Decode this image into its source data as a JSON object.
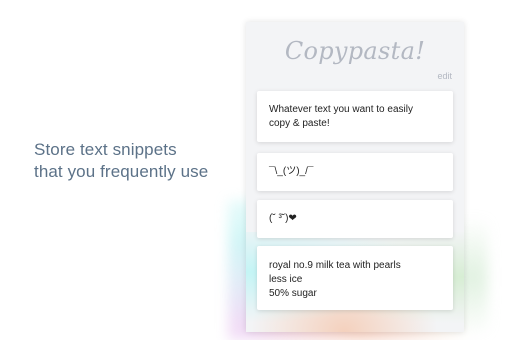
{
  "tagline": {
    "line1": "Store text snippets",
    "line2": "that you frequently use"
  },
  "popup": {
    "title": "Copypasta!",
    "edit_label": "edit",
    "snippets": [
      {
        "lines": [
          "Whatever text you want to easily",
          "copy & paste!"
        ]
      },
      {
        "lines": [
          "¯\\_(ツ)_/¯"
        ]
      },
      {
        "lines": [
          "(˘ ³˘)❤"
        ]
      },
      {
        "lines": [
          "royal no.9 milk tea with pearls",
          "less ice",
          "50% sugar"
        ]
      }
    ]
  },
  "colors": {
    "tagline": "#5c7288",
    "title": "#b3b8c2",
    "popup_bg": "#f3f4f6",
    "card_bg": "#ffffff",
    "card_text": "#222222"
  }
}
